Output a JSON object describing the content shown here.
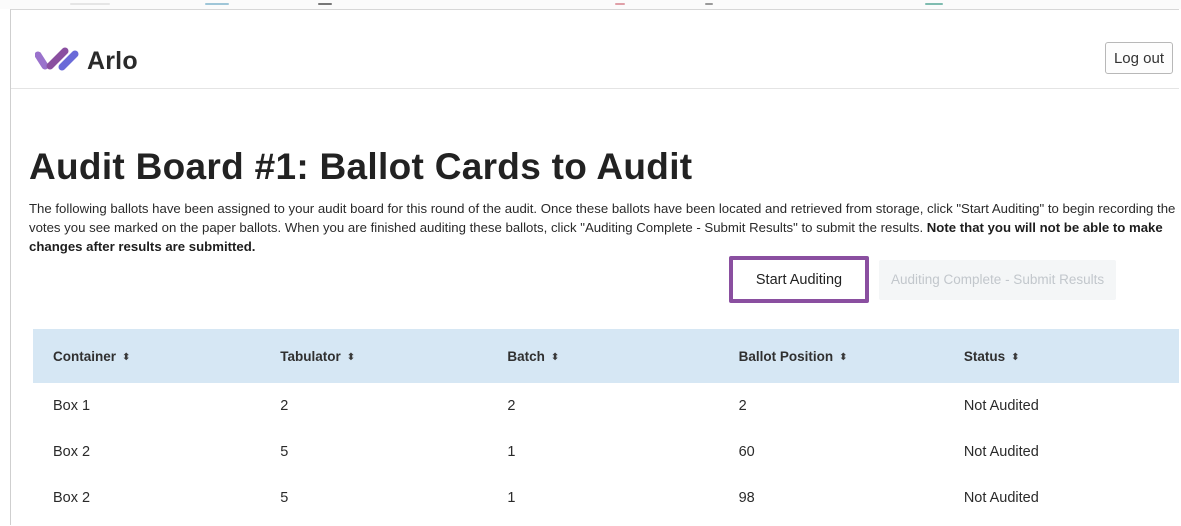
{
  "app": {
    "name": "Arlo",
    "brand_color": "#8a4fa0"
  },
  "header": {
    "logout_label": "Log out"
  },
  "page": {
    "title": "Audit Board #1: Ballot Cards to Audit",
    "intro_text": "The following ballots have been assigned to your audit board for this round of the audit. Once these ballots have been located and retrieved from storage, click \"Start Auditing\" to begin recording the votes you see marked on the paper ballots. When you are finished auditing these ballots, click \"Auditing Complete - Submit Results\" to submit the results. ",
    "intro_bold": "Note that you will not be able to make changes after results are submitted."
  },
  "actions": {
    "start_label": "Start Auditing",
    "submit_label": "Auditing Complete - Submit Results"
  },
  "table": {
    "header_bg": "#d6e7f4",
    "sort_icon": "sort-updown-icon",
    "columns": [
      "Container",
      "Tabulator",
      "Batch",
      "Ballot Position",
      "Status"
    ],
    "rows": [
      {
        "container": "Box 1",
        "tabulator": "2",
        "batch": "2",
        "position": "2",
        "status": "Not Audited"
      },
      {
        "container": "Box 2",
        "tabulator": "5",
        "batch": "1",
        "position": "60",
        "status": "Not Audited"
      },
      {
        "container": "Box 2",
        "tabulator": "5",
        "batch": "1",
        "position": "98",
        "status": "Not Audited"
      }
    ]
  }
}
